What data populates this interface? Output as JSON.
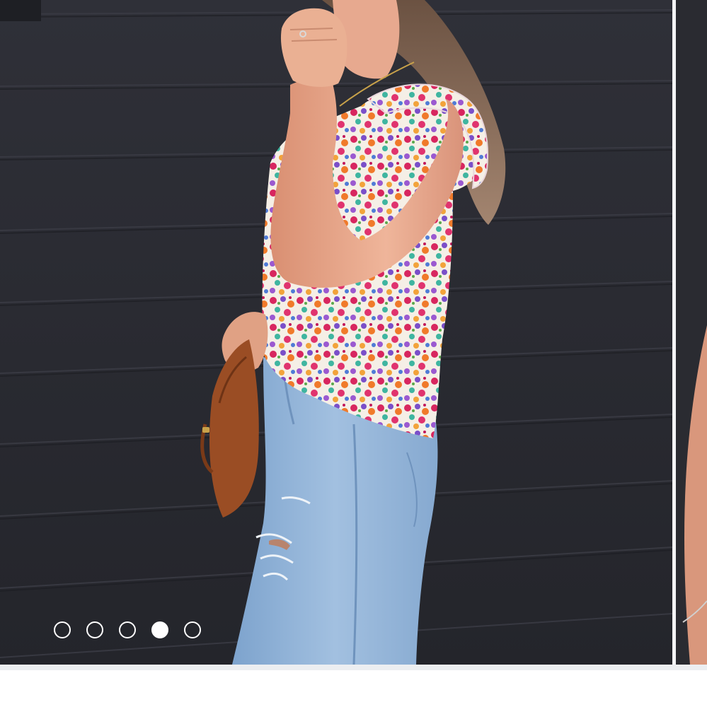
{
  "carousel": {
    "slide_image": {
      "icon": "product-photo",
      "colors": {
        "wall": "#2b2c33",
        "denim": "#8fb2d8",
        "clutch": "#9a4d24",
        "skin": "#e8a98e",
        "hair": "#8a6a52"
      }
    },
    "pagination": {
      "total": 5,
      "active_index": 3,
      "dots": [
        {
          "active": false
        },
        {
          "active": false
        },
        {
          "active": false
        },
        {
          "active": true
        },
        {
          "active": false
        }
      ]
    }
  }
}
